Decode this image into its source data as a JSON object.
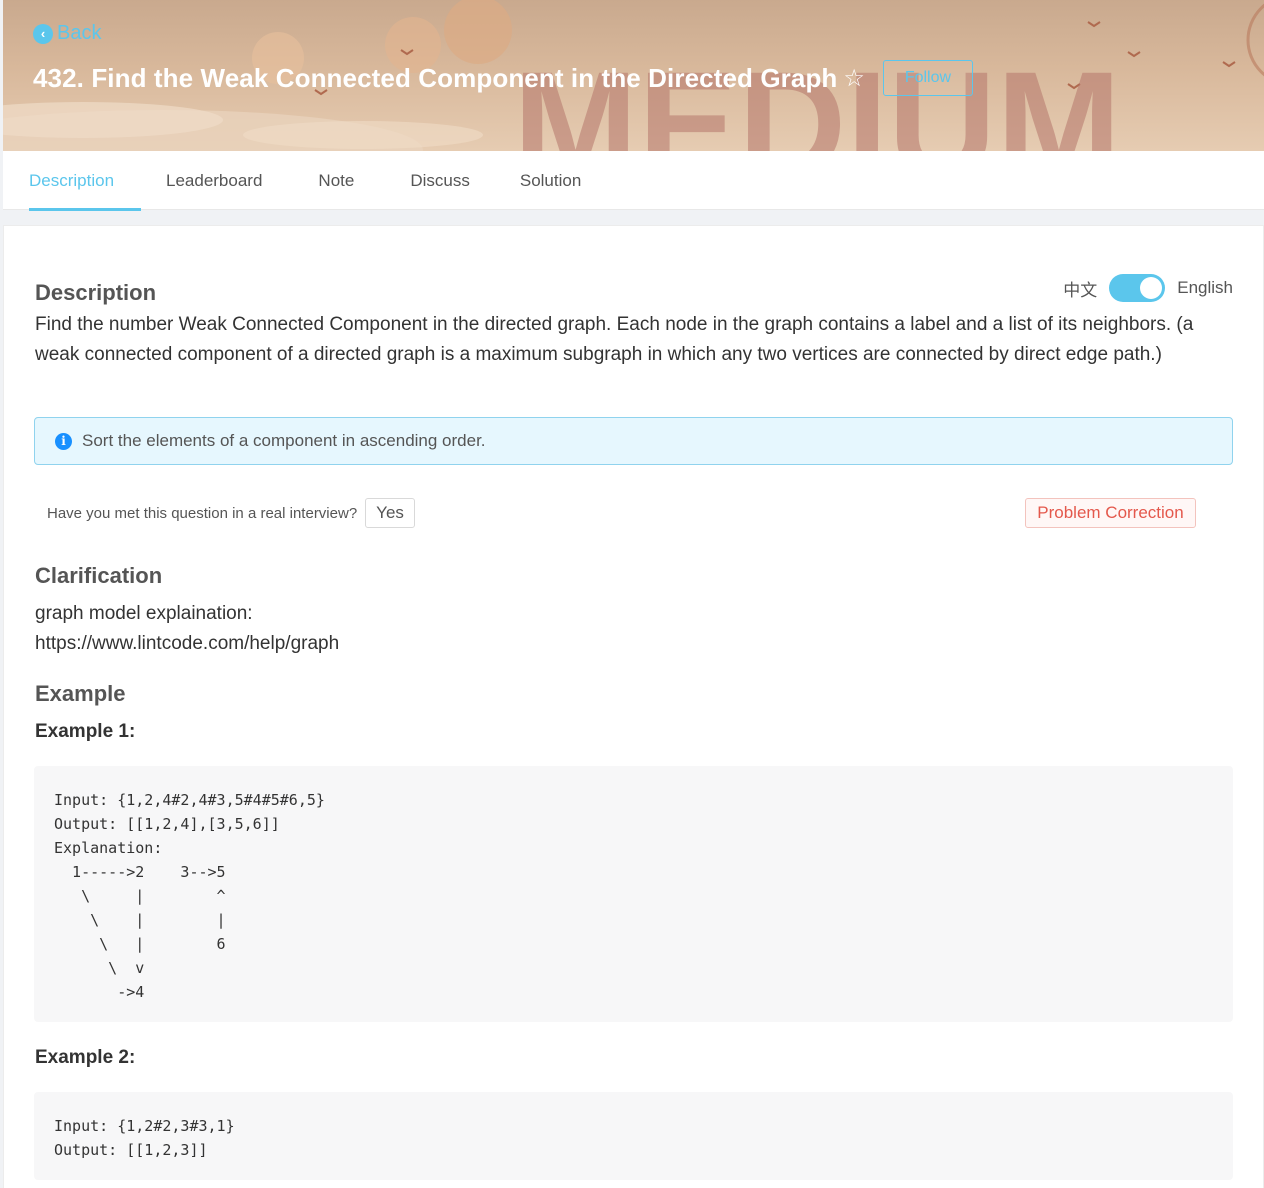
{
  "header": {
    "back_label": "Back",
    "title": "432. Find the Weak Connected Component in the Directed Graph",
    "follow_label": "Follow",
    "difficulty_watermark": "MEDIUM"
  },
  "tabs": [
    {
      "label": "Description",
      "active": true
    },
    {
      "label": "Leaderboard",
      "active": false
    },
    {
      "label": "Note",
      "active": false
    },
    {
      "label": "Discuss",
      "active": false
    },
    {
      "label": "Solution",
      "active": false
    }
  ],
  "description": {
    "heading": "Description",
    "lang_zh": "中文",
    "lang_en": "English",
    "text": "Find the number Weak Connected Component in the directed graph. Each node in the graph contains a label and a list of its neighbors. (a weak connected component of a directed graph is a maximum subgraph in which any two vertices are connected by direct edge path.)",
    "notice": "Sort the elements of a component in ascending order."
  },
  "interview": {
    "question": "Have you met this question in a real interview?",
    "yes_label": "Yes",
    "correction_label": "Problem Correction"
  },
  "clarification": {
    "heading": "Clarification",
    "line1": "graph model explaination:",
    "line2": "https://www.lintcode.com/help/graph"
  },
  "example": {
    "heading": "Example",
    "ex1_title": "Example 1:",
    "ex1_code": "Input: {1,2,4#2,4#3,5#4#5#6,5}\nOutput: [[1,2,4],[3,5,6]]\nExplanation:\n  1----->2    3-->5\n   \\     |        ^\n    \\    |        |\n     \\   |        6\n      \\  v\n       ->4",
    "ex2_title": "Example 2:",
    "ex2_code": "Input: {1,2#2,3#3,1}\nOutput: [[1,2,3]]"
  },
  "colors": {
    "accent": "#5bc6ec",
    "correction": "#e4584c",
    "notice_bg": "#e6f7fe"
  }
}
